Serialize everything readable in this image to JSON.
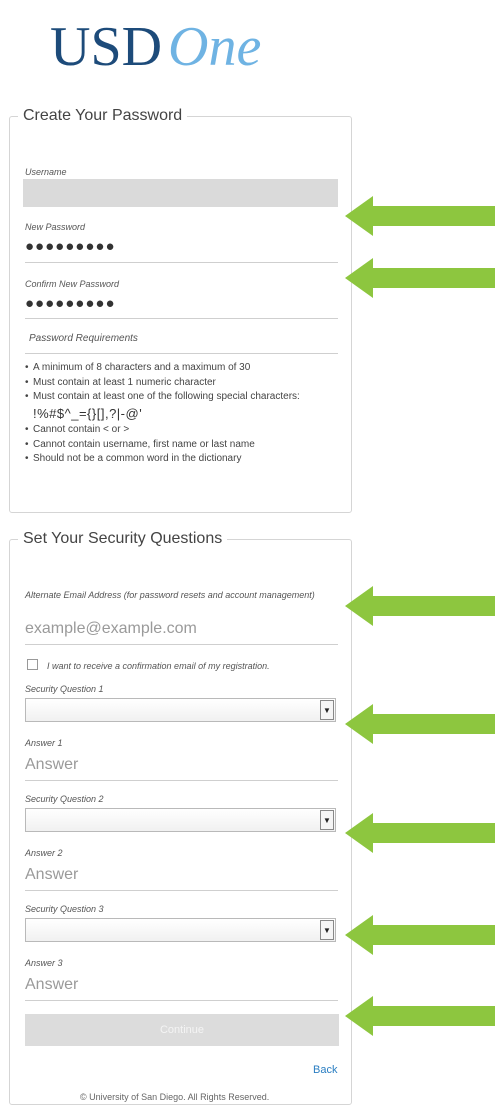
{
  "logo": {
    "part1": "USD",
    "part2": "One"
  },
  "password_section": {
    "title": "Create Your Password",
    "username_label": "Username",
    "new_password_label": "New Password",
    "new_password_value": "●●●●●●●●●",
    "confirm_password_label": "Confirm New Password",
    "confirm_password_value": "●●●●●●●●●",
    "requirements_title": "Password Requirements",
    "requirements": [
      "A minimum of 8 characters and a maximum of 30",
      "Must contain at least 1 numeric character",
      "Must contain at least one of the following special characters:",
      "Cannot contain < or >",
      "Cannot contain username, first name or last name",
      "Should not be a common word in the dictionary"
    ],
    "special_characters": "!%#$^_={}[],?|-@'"
  },
  "security_section": {
    "title": "Set Your Security Questions",
    "email_label": "Alternate Email Address (for password resets and account management)",
    "email_placeholder": "example@example.com",
    "confirmation_checkbox_label": "I want to receive a confirmation email of my registration.",
    "question1_label": "Security Question 1",
    "answer1_label": "Answer 1",
    "answer1_placeholder": "Answer",
    "question2_label": "Security Question 2",
    "answer2_label": "Answer 2",
    "answer2_placeholder": "Answer",
    "question3_label": "Security Question 3",
    "answer3_label": "Answer 3",
    "answer3_placeholder": "Answer",
    "continue_label": "Continue",
    "back_label": "Back"
  },
  "footer": {
    "text": "© University of San Diego. All Rights Reserved."
  },
  "colors": {
    "arrow": "#8dc63f",
    "logo_dark": "#1d4b7a",
    "logo_light": "#6fb3e3",
    "link": "#2a7ec2"
  }
}
